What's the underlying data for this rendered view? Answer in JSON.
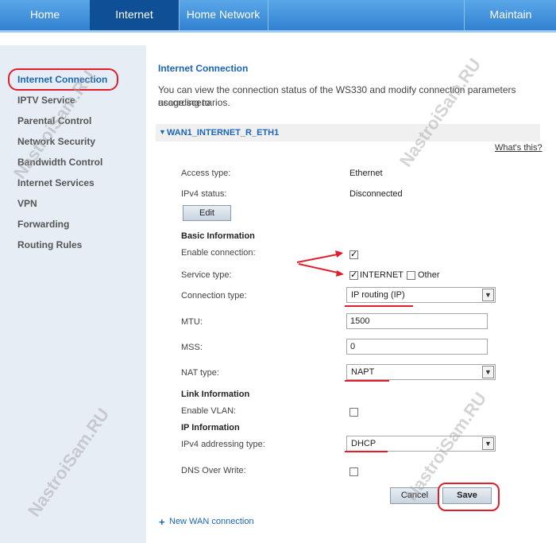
{
  "topnav": {
    "tabs": [
      {
        "label": "Home"
      },
      {
        "label": "Internet"
      },
      {
        "label": "Home Network"
      },
      {
        "label": "Maintain"
      }
    ]
  },
  "sidebar": {
    "items": [
      {
        "label": "Internet Connection"
      },
      {
        "label": "IPTV Service"
      },
      {
        "label": "Parental Control"
      },
      {
        "label": "Network Security"
      },
      {
        "label": "Bandwidth Control"
      },
      {
        "label": "Internet Services"
      },
      {
        "label": "VPN"
      },
      {
        "label": "Forwarding"
      },
      {
        "label": "Routing Rules"
      }
    ]
  },
  "page": {
    "title": "Internet Connection",
    "description_line1": "You can view the connection status of the WS330 and modify connection parameters according to",
    "description_line2": "usage scenarios.",
    "wan_name": "WAN1_INTERNET_R_ETH1",
    "whats_this": "What's this?"
  },
  "fields": {
    "access_type_label": "Access type:",
    "access_type_value": "Ethernet",
    "ipv4_status_label": "IPv4 status:",
    "ipv4_status_value": "Disconnected",
    "edit_button": "Edit",
    "basic_info": "Basic Information",
    "enable_connection_label": "Enable connection:",
    "service_type_label": "Service type:",
    "service_internet": "INTERNET",
    "service_other": "Other",
    "connection_type_label": "Connection type:",
    "connection_type_value": "IP routing (IP)",
    "mtu_label": "MTU:",
    "mtu_value": "1500",
    "mss_label": "MSS:",
    "mss_value": "0",
    "nat_type_label": "NAT type:",
    "nat_type_value": "NAPT",
    "link_info": "Link Information",
    "enable_vlan_label": "Enable VLAN:",
    "ip_info": "IP Information",
    "ipv4_addressing_label": "IPv4 addressing type:",
    "ipv4_addressing_value": "DHCP",
    "dns_overwrite_label": "DNS Over Write:"
  },
  "buttons": {
    "cancel": "Cancel",
    "save": "Save"
  },
  "footer": {
    "new_wan": "New WAN connection"
  },
  "watermark": "NastroiSam.RU",
  "colors": {
    "accent": "#1a66b8",
    "annotation_red": "#e01e2c",
    "nav_active": "#0f4f96"
  }
}
